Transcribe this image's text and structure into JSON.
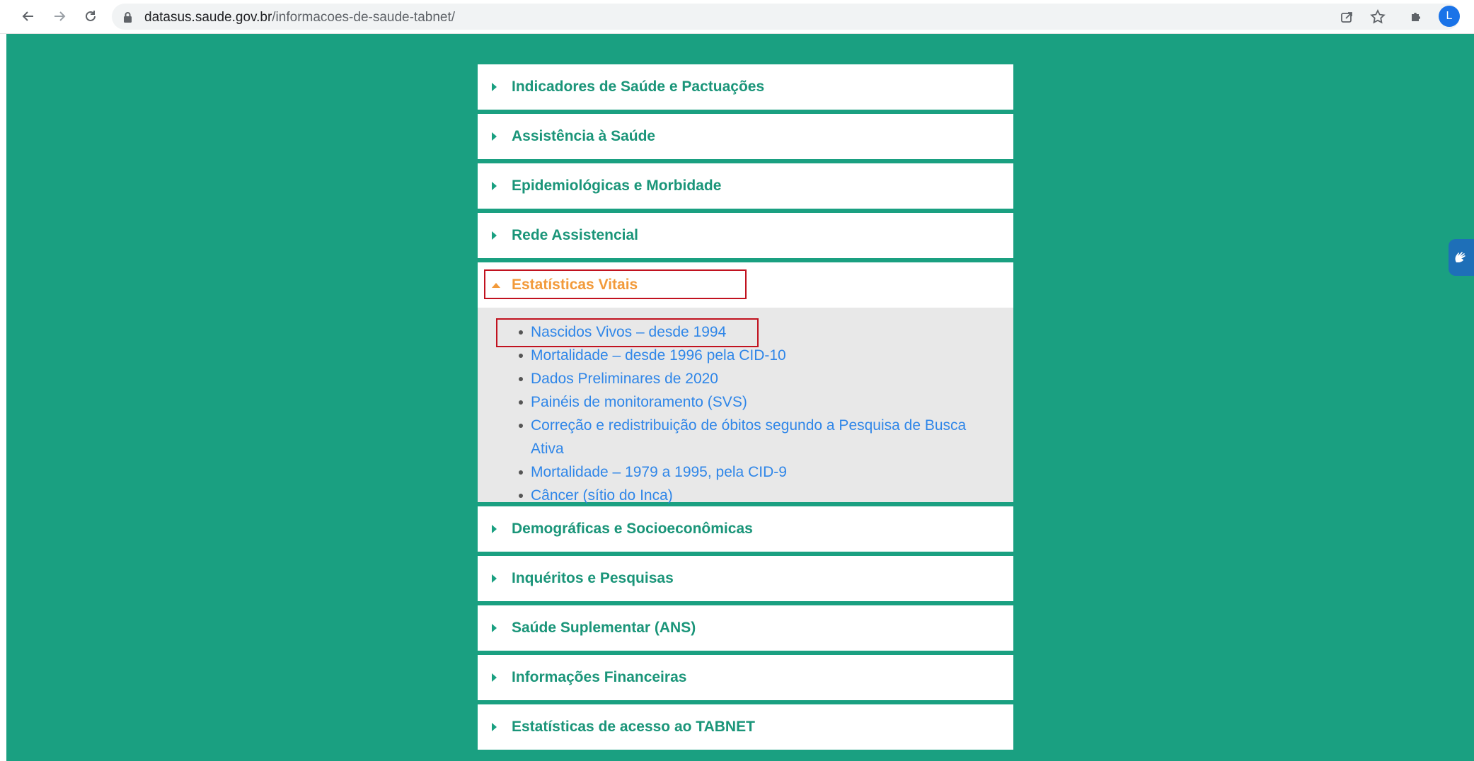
{
  "browser": {
    "url_host": "datasus.saude.gov.br",
    "url_path": "/informacoes-de-saude-tabnet/",
    "profile_initial": "L"
  },
  "accordion": {
    "sections": [
      {
        "label": "Indicadores de Saúde e Pactuações"
      },
      {
        "label": "Assistência à Saúde"
      },
      {
        "label": "Epidemiológicas e Morbidade"
      },
      {
        "label": "Rede Assistencial"
      },
      {
        "label": "Estatísticas Vitais",
        "open": true
      },
      {
        "label": "Demográficas e Socioeconômicas"
      },
      {
        "label": "Inquéritos e Pesquisas"
      },
      {
        "label": "Saúde Suplementar (ANS)"
      },
      {
        "label": "Informações Financeiras"
      },
      {
        "label": "Estatísticas de acesso ao TABNET"
      }
    ],
    "open_links": [
      "Nascidos Vivos – desde 1994",
      "Mortalidade – desde 1996 pela CID-10",
      "Dados Preliminares de 2020",
      "Painéis de monitoramento (SVS)",
      "Correção e redistribuição de óbitos segundo a Pesquisa de Busca Ativa",
      "Mortalidade – 1979 a 1995, pela CID-9",
      "Câncer (sítio do Inca)"
    ]
  },
  "colors": {
    "page_bg": "#1aa081",
    "section_title": "#1a9579",
    "open_title": "#f29a3a",
    "link": "#2f86e8",
    "highlight": "#c1121f"
  }
}
